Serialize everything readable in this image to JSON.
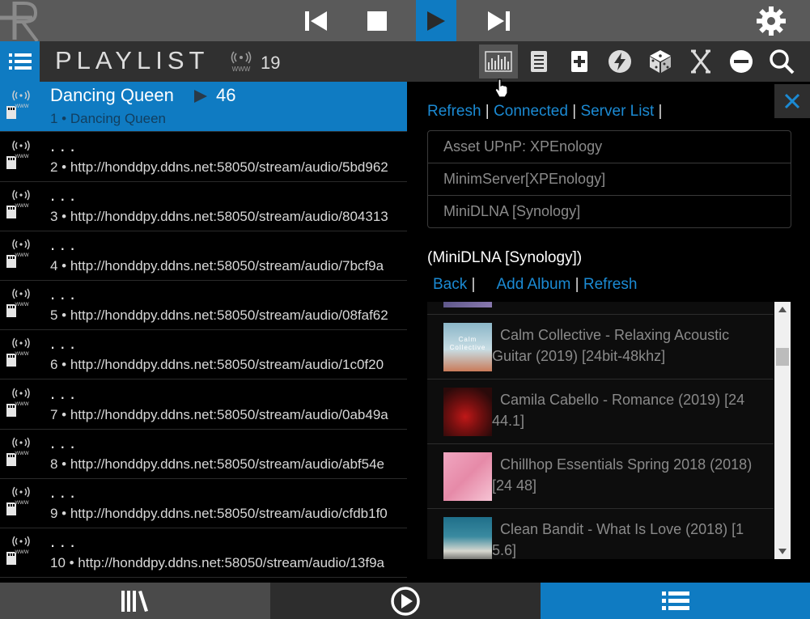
{
  "colors": {
    "accent": "#0f7bc2",
    "link": "#1b8ad3",
    "toolbar": "#5a5a5a",
    "header": "#303030"
  },
  "transport": {
    "logo_icon": "app-logo-icon",
    "prev_icon": "skip-previous-icon",
    "stop_icon": "stop-icon",
    "play_icon": "play-icon",
    "next_icon": "skip-next-icon",
    "settings_icon": "gear-icon"
  },
  "header": {
    "title": "PLAYLIST",
    "stream_icon": "stream-icon",
    "track_count": "19",
    "toolbar_icons": [
      "visualizer-icon",
      "list-icon",
      "add-icon",
      "flash-icon",
      "dice-icon",
      "crossfade-icon",
      "remove-icon",
      "search-icon"
    ]
  },
  "playlist": {
    "now_playing": {
      "title": "Dancing Queen",
      "play_count": "46",
      "subtitle": "1 • Dancing Queen"
    },
    "rows": [
      {
        "title": ". . .",
        "subtitle": "2 • http://honddpy.ddns.net:58050/stream/audio/5bd962"
      },
      {
        "title": ". . .",
        "subtitle": "3 • http://honddpy.ddns.net:58050/stream/audio/804313"
      },
      {
        "title": ". . .",
        "subtitle": "4 • http://honddpy.ddns.net:58050/stream/audio/7bcf9a"
      },
      {
        "title": ". . .",
        "subtitle": "5 • http://honddpy.ddns.net:58050/stream/audio/08faf62"
      },
      {
        "title": ". . .",
        "subtitle": "6 • http://honddpy.ddns.net:58050/stream/audio/1c0f20"
      },
      {
        "title": ". . .",
        "subtitle": "7 • http://honddpy.ddns.net:58050/stream/audio/0ab49a"
      },
      {
        "title": ". . .",
        "subtitle": "8 • http://honddpy.ddns.net:58050/stream/audio/abf54e"
      },
      {
        "title": ". . .",
        "subtitle": "9 • http://honddpy.ddns.net:58050/stream/audio/cfdb1f0"
      },
      {
        "title": ". . .",
        "subtitle": "10 • http://honddpy.ddns.net:58050/stream/audio/13f9a"
      }
    ]
  },
  "server_panel": {
    "links": {
      "refresh": "Refresh",
      "connected": "Connected",
      "server_list": "Server List",
      "separator": " | "
    },
    "servers": [
      "Asset UPnP: XPEnology",
      "MinimServer[XPEnology]",
      "MiniDLNA [Synology]"
    ],
    "current": "(MiniDLNA [Synology])",
    "album_links": {
      "back": "Back",
      "add_album": "Add Album",
      "refresh": "Refresh",
      "separator": " | "
    },
    "albums": [
      {
        "line1": "Calm Collective - Relaxing Acoustic",
        "line2": "Guitar (2019) [24bit-48khz]",
        "cover_text": "Calm Collective"
      },
      {
        "line1": "Camila Cabello - Romance (2019) [24",
        "line2": "44.1]"
      },
      {
        "line1": "Chillhop Essentials Spring 2018 (2018)",
        "line2": "[24 48]"
      },
      {
        "line1": "Clean Bandit - What Is Love (2018) [1",
        "line2": "5.6]"
      }
    ]
  },
  "bottom_nav": {
    "library_icon": "library-icon",
    "now_playing_icon": "play-circle-icon",
    "playlist_icon": "playlist-icon"
  }
}
